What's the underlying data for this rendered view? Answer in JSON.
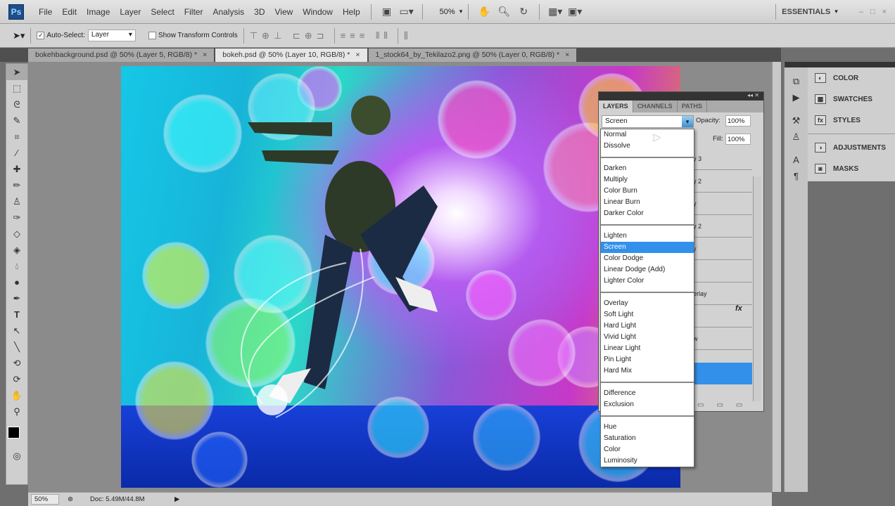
{
  "menubar": {
    "logo": "Ps",
    "items": [
      "File",
      "Edit",
      "Image",
      "Layer",
      "Select",
      "Filter",
      "Analysis",
      "3D",
      "View",
      "Window",
      "Help"
    ],
    "zoom": "50%",
    "workspace": "ESSENTIALS"
  },
  "options": {
    "auto_select_label": "Auto-Select:",
    "auto_select_value": "Layer",
    "show_transform": "Show Transform Controls"
  },
  "tabs": [
    {
      "label": "bokehbackground.psd @ 50% (Layer 5, RGB/8) *"
    },
    {
      "label": "bokeh.psd @ 50% (Layer 10, RGB/8) *"
    },
    {
      "label": "1_stock64_by_Tekilazo2.png @ 50% (Layer 0, RGB/8) *"
    }
  ],
  "dock": {
    "items": [
      "COLOR",
      "SWATCHES",
      "STYLES",
      "ADJUSTMENTS",
      "MASKS"
    ]
  },
  "layers_panel": {
    "tabs": [
      "LAYERS",
      "CHANNELS",
      "PATHS"
    ],
    "blend_mode": "Screen",
    "opacity_label": "Opacity:",
    "opacity": "100%",
    "fill_label": "Fill:",
    "fill": "100%",
    "row_fragments": [
      "y 3",
      "y 2",
      "y",
      "y 2",
      "y",
      "",
      "erlay",
      "",
      "w",
      ""
    ],
    "fx": "fx"
  },
  "blend_menu": {
    "groups": [
      [
        "Normal",
        "Dissolve"
      ],
      [
        "Darken",
        "Multiply",
        "Color Burn",
        "Linear Burn",
        "Darker Color"
      ],
      [
        "Lighten",
        "Screen",
        "Color Dodge",
        "Linear Dodge (Add)",
        "Lighter Color"
      ],
      [
        "Overlay",
        "Soft Light",
        "Hard Light",
        "Vivid Light",
        "Linear Light",
        "Pin Light",
        "Hard Mix"
      ],
      [
        "Difference",
        "Exclusion"
      ],
      [
        "Hue",
        "Saturation",
        "Color",
        "Luminosity"
      ]
    ],
    "selected": "Screen"
  },
  "status": {
    "zoom": "50%",
    "doc": "Doc: 5.49M/44.8M"
  }
}
